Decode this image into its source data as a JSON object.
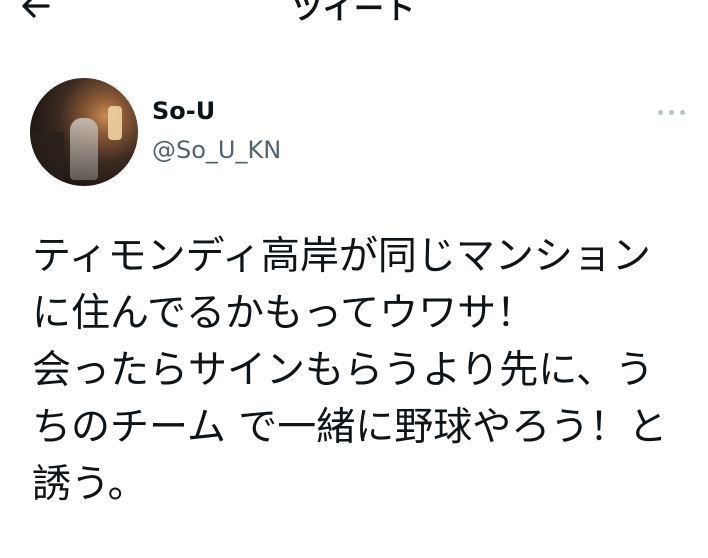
{
  "header": {
    "title": "ツイート"
  },
  "tweet": {
    "author": {
      "display_name": "So-U",
      "handle": "@So_U_KN"
    },
    "text": "ティモンディ高岸が同じマンションに住んでるかもってウワサ！\n会ったらサインもらうより先に、うちのチーム で一緒に野球やろう！と誘う。"
  },
  "icons": {
    "back": "arrow-left-icon",
    "more": "more-horizontal-icon"
  },
  "colors": {
    "text_primary": "#0f1419",
    "text_secondary": "#536471"
  }
}
